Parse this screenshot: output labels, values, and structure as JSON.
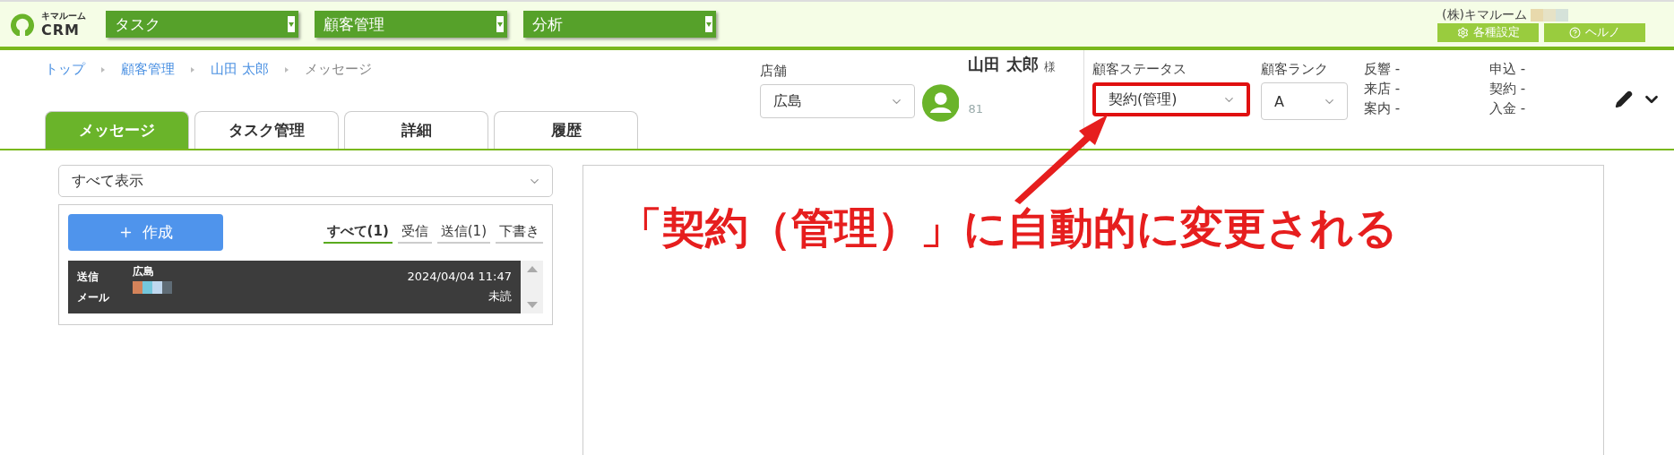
{
  "header": {
    "logo": {
      "kana": "キマルーム",
      "name": "CRM"
    },
    "menus": [
      {
        "label": "タスク"
      },
      {
        "label": "顧客管理"
      },
      {
        "label": "分析"
      }
    ],
    "company": "(株)キマルーム",
    "buttons": [
      {
        "kind": "settings",
        "label": "各種設定"
      },
      {
        "kind": "help",
        "label": "ヘルノ"
      }
    ]
  },
  "breadcrumb": [
    {
      "label": "トップ",
      "link": true
    },
    {
      "label": "顧客管理",
      "link": true
    },
    {
      "label": "山田 太郎",
      "link": true
    },
    {
      "label": "メッセージ",
      "link": false
    }
  ],
  "tabs": [
    {
      "label": "メッセージ",
      "selected": true
    },
    {
      "label": "タスク管理",
      "selected": false
    },
    {
      "label": "詳細",
      "selected": false
    },
    {
      "label": "履歴",
      "selected": false
    }
  ],
  "customer": {
    "store_label": "店舗",
    "store": "広島",
    "name": "山田 太郎",
    "honorific": "様",
    "number": "81",
    "status_label": "顧客ステータス",
    "status": "契約(管理)",
    "status_highlighted": true,
    "rank_label": "顧客ランク",
    "rank": "A",
    "stats": [
      "反響 -",
      "来店 -",
      "案内 -",
      "申込 -",
      "契約 -",
      "入金 -"
    ]
  },
  "filter": {
    "value": "すべて表示"
  },
  "compose": {
    "label": "作成"
  },
  "message_tabs": [
    {
      "label": "すべて(1)",
      "selected": true
    },
    {
      "label": "受信",
      "selected": false
    },
    {
      "label": "送信(1)",
      "selected": false
    },
    {
      "label": "下書き",
      "selected": false
    }
  ],
  "messages": [
    {
      "direction": "送信",
      "type": "メール",
      "store": "広島",
      "date": "2024/04/04 11:47",
      "status": "未読"
    }
  ],
  "annotation": {
    "text": "「契約（管理）」に自動的に変更される"
  }
}
